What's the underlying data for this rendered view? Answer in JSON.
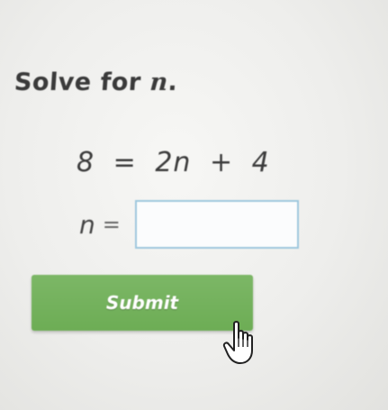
{
  "question": {
    "prompt_text": "Solve for",
    "variable": "n",
    "prompt_end": "."
  },
  "equation": {
    "lhs": "8",
    "eq": "=",
    "rhs_coef": "2n",
    "op": "+",
    "rhs_const": "4"
  },
  "answer": {
    "variable": "n",
    "eq": "=",
    "value": "",
    "placeholder": ""
  },
  "submit": {
    "label": "Submit"
  },
  "colors": {
    "button": "#74b15d",
    "input_border": "#9ec8de"
  },
  "icons": {
    "cursor": "hand-pointer-icon"
  }
}
